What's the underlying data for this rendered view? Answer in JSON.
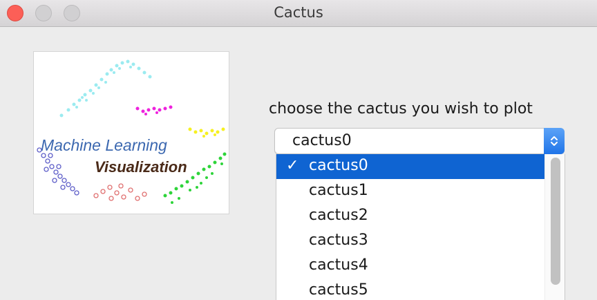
{
  "window": {
    "title": "Cactus",
    "controls": {
      "close": "close-button",
      "minimize": "minimize-button",
      "maximize": "zoom-button"
    }
  },
  "logo": {
    "line1": "Machine Learning",
    "line2": "Visualization"
  },
  "prompt": "choose the cactus you wish to plot",
  "combo": {
    "selected": "cactus0"
  },
  "dropdown": {
    "check": "✓",
    "options": [
      "cactus0",
      "cactus1",
      "cactus2",
      "cactus3",
      "cactus4",
      "cactus5"
    ],
    "selected_index": 0
  },
  "colors": {
    "accent": "#0f64d2",
    "close": "#fc5f57"
  }
}
